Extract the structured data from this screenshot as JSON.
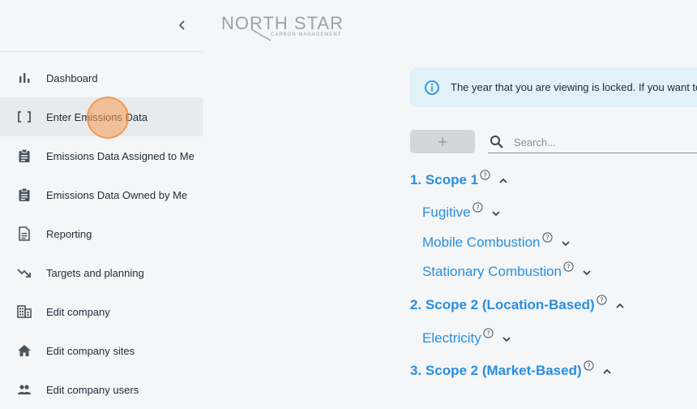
{
  "sidebar": {
    "collapse_icon": "chevron-left-icon",
    "items": [
      {
        "label": "Dashboard",
        "icon": "bar-chart-icon"
      },
      {
        "label": "Enter Emissions Data",
        "icon": "brackets-icon"
      },
      {
        "label": "Emissions Data Assigned to Me",
        "icon": "clipboard-icon"
      },
      {
        "label": "Emissions Data Owned by Me",
        "icon": "clipboard-icon"
      },
      {
        "label": "Reporting",
        "icon": "document-icon"
      },
      {
        "label": "Targets and planning",
        "icon": "trending-down-icon"
      },
      {
        "label": "Edit company",
        "icon": "building-icon"
      },
      {
        "label": "Edit company sites",
        "icon": "home-icon"
      },
      {
        "label": "Edit company users",
        "icon": "users-icon"
      }
    ],
    "active_index": 1
  },
  "logo": {
    "main": "NORTH STAR",
    "sub": "CARBON MANAGEMENT"
  },
  "banner": {
    "icon": "info-icon",
    "text": "The year that you are viewing is locked. If you want to"
  },
  "toolbar": {
    "add_label": "+",
    "search_placeholder": "Search..."
  },
  "scopes": [
    {
      "title": "1. Scope 1",
      "expanded": true,
      "children": [
        "Fugitive",
        "Mobile Combustion",
        "Stationary Combustion"
      ]
    },
    {
      "title": "2. Scope 2 (Location-Based)",
      "expanded": true,
      "children": [
        "Electricity"
      ]
    },
    {
      "title": "3. Scope 2 (Market-Based)",
      "expanded": true,
      "children": []
    }
  ],
  "colors": {
    "accent": "#2a8ee0",
    "banner_bg": "#e0f1f9",
    "active_bg": "#e8ebee"
  }
}
